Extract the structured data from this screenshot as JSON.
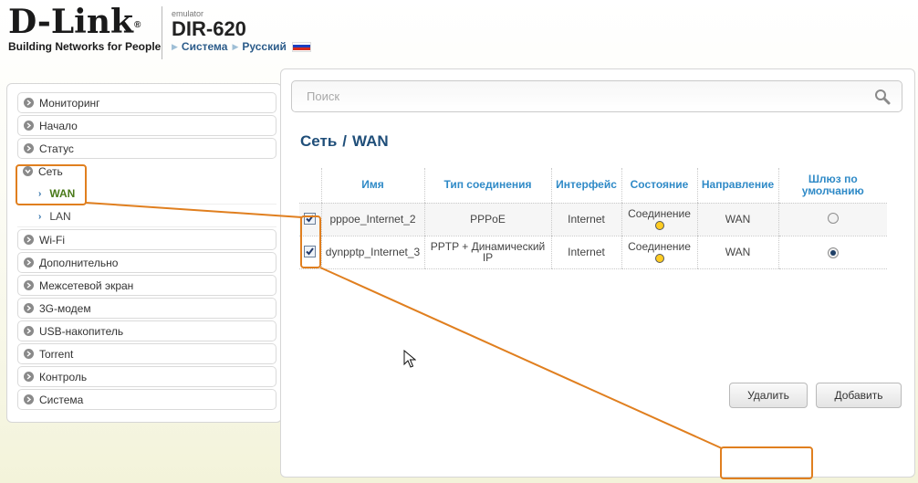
{
  "header": {
    "logo_text": "D-Link",
    "logo_reg": "®",
    "logo_tagline": "Building Networks for People",
    "emulator_label": "emulator",
    "model": "DIR-620",
    "crumbs": [
      "Система",
      "Русский"
    ]
  },
  "sidebar": {
    "items": [
      {
        "label": "Мониторинг"
      },
      {
        "label": "Начало"
      },
      {
        "label": "Статус"
      },
      {
        "label": "Сеть"
      },
      {
        "label": "WAN"
      },
      {
        "label": "LAN"
      },
      {
        "label": "Wi-Fi"
      },
      {
        "label": "Дополнительно"
      },
      {
        "label": "Межсетевой экран"
      },
      {
        "label": "3G-модем"
      },
      {
        "label": "USB-накопитель"
      },
      {
        "label": "Torrent"
      },
      {
        "label": "Контроль"
      },
      {
        "label": "Система"
      }
    ]
  },
  "search": {
    "placeholder": "Поиск"
  },
  "page_title": {
    "section": "Сеть",
    "separator": "/",
    "page": "WAN"
  },
  "table": {
    "headers": [
      "Имя",
      "Тип соединения",
      "Интерфейс",
      "Состояние",
      "Направление",
      "Шлюз по умолчанию"
    ],
    "rows": [
      {
        "checked": true,
        "name": "pppoe_Internet_2",
        "type": "PPPoE",
        "interface": "Internet",
        "state": "Соединение",
        "direction": "WAN",
        "default_gw": false
      },
      {
        "checked": true,
        "name": "dynpptp_Internet_3",
        "type": "PPTP + Динамический IP",
        "interface": "Internet",
        "state": "Соединение",
        "direction": "WAN",
        "default_gw": true
      }
    ]
  },
  "buttons": {
    "delete": "Удалить",
    "add": "Добавить"
  },
  "colors": {
    "accent": "#2f8ac7",
    "title": "#1f4e79",
    "highlight": "#e07f1f",
    "status_dot": "#ffcc22"
  }
}
